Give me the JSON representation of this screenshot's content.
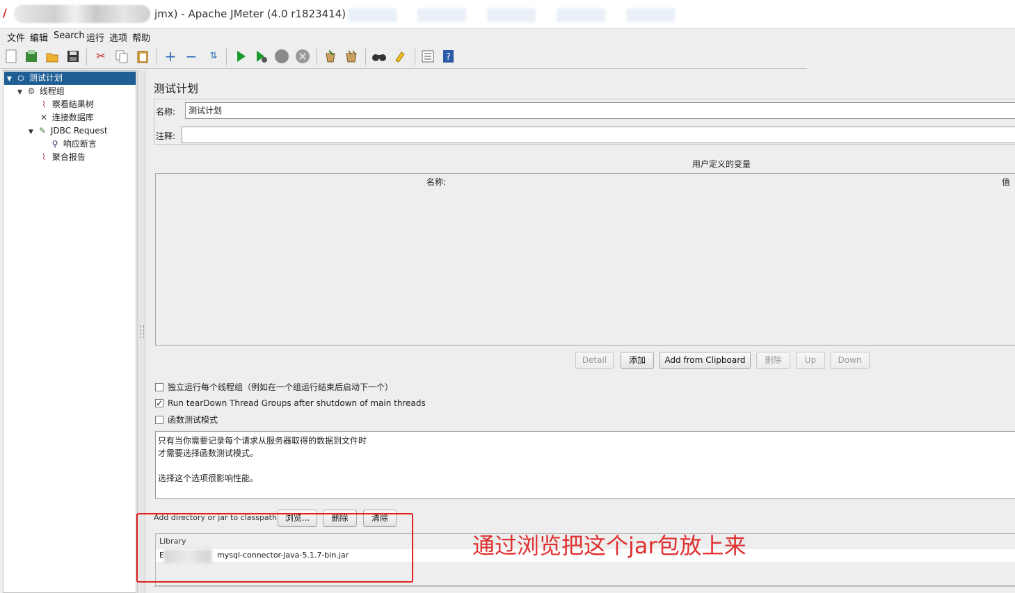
{
  "window": {
    "title": "jmx) - Apache JMeter (4.0 r1823414)"
  },
  "menu": [
    "文件",
    "编辑",
    "Search",
    "运行",
    "选项",
    "帮助"
  ],
  "toolbar": {
    "icons": [
      "new-icon",
      "templates-icon",
      "open-icon",
      "save-icon",
      "cut-icon",
      "copy-icon",
      "paste-icon",
      "expand-icon",
      "collapse-icon",
      "toggle-icon",
      "start-icon",
      "start-no-pause-icon",
      "stop-icon",
      "shutdown-icon",
      "clear-icon",
      "clear-all-icon",
      "search-icon",
      "reset-search-icon",
      "function-helper-icon",
      "help-icon"
    ]
  },
  "tree": {
    "items": [
      {
        "label": "测试计划",
        "icon": "test-plan-icon",
        "toggle": "▼"
      },
      {
        "label": "线程组",
        "icon": "thread-group-icon",
        "toggle": "▼"
      },
      {
        "label": "察看结果树",
        "icon": "listener-icon",
        "toggle": ""
      },
      {
        "label": "连接数据库",
        "icon": "config-icon",
        "toggle": ""
      },
      {
        "label": "JDBC Request",
        "icon": "sampler-icon",
        "toggle": "▼"
      },
      {
        "label": "响应断言",
        "icon": "assertion-icon",
        "toggle": ""
      },
      {
        "label": "聚合报告",
        "icon": "listener-icon",
        "toggle": ""
      }
    ]
  },
  "main": {
    "title": "测试计划",
    "name_label": "名称:",
    "name_value": "测试计划",
    "comment_label": "注释:",
    "comment_value": "",
    "vars_title": "用户定义的变量",
    "table_headers": {
      "name": "名称:",
      "value": "值"
    },
    "buttons": {
      "detail": "Detail",
      "add": "添加",
      "add_clipboard": "Add from Clipboard",
      "delete": "删除",
      "up": "Up",
      "down": "Down"
    },
    "checkboxes": [
      {
        "label": "独立运行每个线程组（例如在一个组运行结束后启动下一个）",
        "checked": false
      },
      {
        "label": "Run tearDown Thread Groups after shutdown of main threads",
        "checked": true
      },
      {
        "label": "函数测试模式",
        "checked": false
      }
    ],
    "note_lines": [
      "只有当你需要记录每个请求从服务器取得的数据到文件时",
      "才需要选择函数测试模式。",
      "",
      "选择这个选项很影响性能。"
    ],
    "classpath_label": "Add directory or jar to classpath",
    "classpath_buttons": {
      "browse": "浏览...",
      "delete": "删除",
      "clear": "清除"
    },
    "library_header": "Library",
    "library_row_prefix": "E:",
    "library_row_file": "mysql-connector-java-5.1.7-bin.jar"
  },
  "annotation": {
    "text": "通过浏览把这个jar包放上来",
    "color": "#e03030"
  },
  "colors": {
    "tree_selected": "#1f5e94",
    "annotation_box": "#e02020"
  }
}
